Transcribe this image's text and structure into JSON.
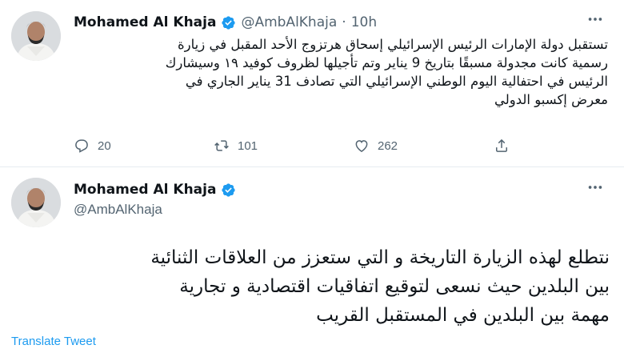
{
  "tweet1": {
    "author": {
      "display_name": "Mohamed Al Khaja",
      "handle": "@AmbAlKhaja",
      "verified": true
    },
    "separator": "·",
    "time": "10h",
    "text_lines": [
      "تستقبل دولة الإمارات الرئيس الإسرائيلي إسحاق هرتزوج  الأحد المقبل في زيارة",
      "رسمية  كانت مجدولة مسبقًا بتاريخ 9 يناير وتم تأجيلها لظروف كوفيد ١٩ وسيشارك",
      "الرئيس في احتفالية اليوم الوطني الإسرائيلي التي تصادف 31 يناير الجاري في",
      "معرض إكسبو الدولي"
    ],
    "actions": {
      "replies": "20",
      "retweets": "101",
      "likes": "262"
    }
  },
  "tweet2": {
    "author": {
      "display_name": "Mohamed Al Khaja",
      "handle": "@AmbAlKhaja",
      "verified": true
    },
    "text_lines": [
      "نتطلع لهذه الزيارة التاريخة و التي ستعزز من العلاقات الثنائية",
      "بين البلدين حيث نسعى لتوقيع اتفاقيات اقتصادية و تجارية",
      "مهمة بين البلدين في المستقبل القريب"
    ],
    "translate_label": "Translate Tweet"
  },
  "colors": {
    "accent": "#1d9bf0",
    "secondary_text": "#536471",
    "primary_text": "#0f1419",
    "divider": "#e6ecf0"
  },
  "icons": {
    "verified": "verified-badge-icon",
    "more": "more-horizontal-icon",
    "reply": "reply-icon",
    "retweet": "retweet-icon",
    "like": "heart-icon",
    "share": "share-icon"
  }
}
